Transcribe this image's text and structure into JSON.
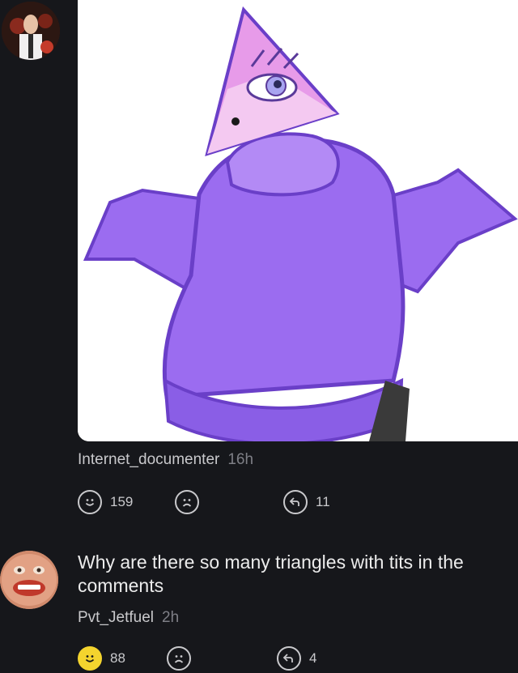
{
  "comment1": {
    "username": "Internet_documenter",
    "time": "16h",
    "actions": {
      "like_count": "159",
      "reply_count": "11"
    }
  },
  "comment2": {
    "text": "Why are there so many triangles with tits in the comments",
    "username": "Pvt_Jetfuel",
    "time": "2h",
    "actions": {
      "like_count": "88",
      "reply_count": "4",
      "liked": true
    }
  },
  "colors": {
    "background": "#16171b",
    "liked_accent": "#f4d42e",
    "hoodie": "#9b6cf0",
    "triangle": "#e79be9"
  }
}
